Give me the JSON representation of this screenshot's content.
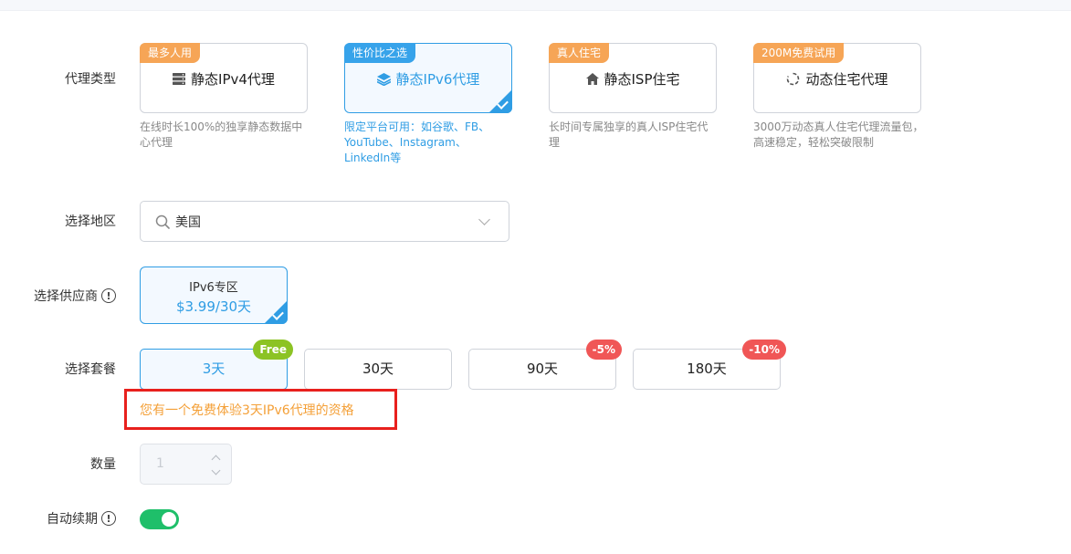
{
  "labels": {
    "proxy_type": "代理类型",
    "region": "选择地区",
    "provider": "选择供应商",
    "plan": "选择套餐",
    "quantity": "数量",
    "auto_renew": "自动续期"
  },
  "proxy_types": [
    {
      "tag": "最多人用",
      "title": "静态IPv4代理",
      "icon": "server-icon",
      "desc": "在线时长100%的独享静态数据中心代理",
      "selected": false
    },
    {
      "tag": "性价比之选",
      "title": "静态IPv6代理",
      "icon": "layers-icon",
      "desc": "限定平台可用：如谷歌、FB、YouTube、Instagram、LinkedIn等",
      "selected": true
    },
    {
      "tag": "真人住宅",
      "title": "静态ISP住宅",
      "icon": "home-icon",
      "desc": "长时间专属独享的真人ISP住宅代理",
      "selected": false
    },
    {
      "tag": "200M免费试用",
      "title": "动态住宅代理",
      "icon": "refresh-icon",
      "desc": "3000万动态真人住宅代理流量包，高速稳定，轻松突破限制",
      "selected": false
    }
  ],
  "region": {
    "value": "美国"
  },
  "provider": {
    "name": "IPv6专区",
    "price": "$3.99/30天"
  },
  "plans": [
    {
      "label": "3天",
      "badge": "Free",
      "selected": true
    },
    {
      "label": "30天",
      "badge": "",
      "selected": false
    },
    {
      "label": "90天",
      "badge": "-5%",
      "selected": false
    },
    {
      "label": "180天",
      "badge": "-10%",
      "selected": false
    }
  ],
  "free_note": "您有一个免费体验3天IPv6代理的资格",
  "quantity": {
    "value": "1"
  },
  "auto_renew": {
    "enabled": true
  },
  "colors": {
    "accent": "#2f9de4",
    "tag_orange": "#f6a556",
    "badge_green": "#8cc324",
    "badge_red": "#f05656",
    "toggle_on": "#1fbf6a",
    "note_text": "#f4a038",
    "highlight_box": "#e8201d"
  }
}
